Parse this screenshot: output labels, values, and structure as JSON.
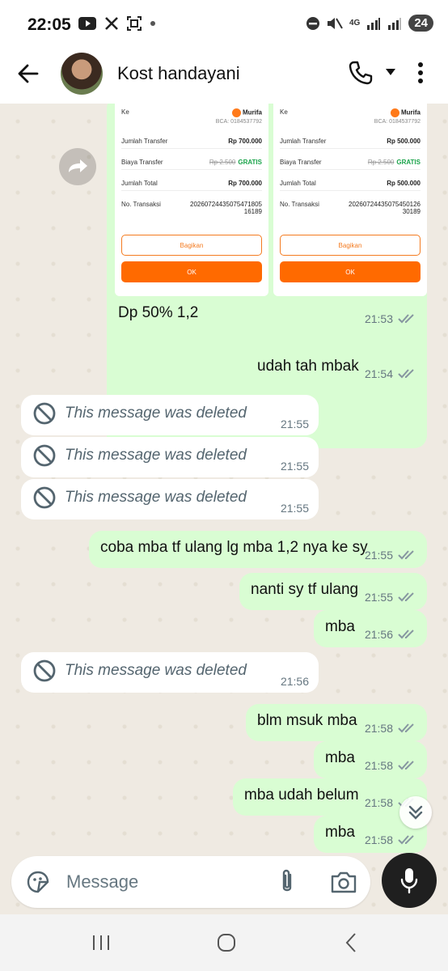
{
  "status_bar": {
    "time": "22:05",
    "network": "4G",
    "battery": "24",
    "notification_icons": [
      "youtube-icon",
      "x-icon",
      "screenshot-icon",
      "dot-icon"
    ]
  },
  "header": {
    "contact_name": "Kost handayani"
  },
  "receipts": [
    {
      "to_label": "Ke",
      "recipient": "Murifa",
      "bank": "BCA: 0184537792",
      "rows": [
        {
          "label": "Jumlah Transfer",
          "value": "Rp 700.000"
        },
        {
          "label": "Biaya Transfer",
          "strike": "Rp 2.500",
          "value": "GRATIS"
        },
        {
          "label": "Jumlah Total",
          "value": "Rp 700.000"
        },
        {
          "label": "No. Transaksi",
          "value": "20260724435075471805 16189"
        }
      ],
      "share_label": "Bagikan",
      "ok_label": "OK"
    },
    {
      "to_label": "Ke",
      "recipient": "Murifa",
      "bank": "BCA: 0184537792",
      "rows": [
        {
          "label": "Jumlah Transfer",
          "value": "Rp 500.000"
        },
        {
          "label": "Biaya Transfer",
          "strike": "Rp 2.500",
          "value": "GRATIS"
        },
        {
          "label": "Jumlah Total",
          "value": "Rp 500.000"
        },
        {
          "label": "No. Transaksi",
          "value": "20260724435075450126 30189"
        }
      ],
      "share_label": "Bagikan",
      "ok_label": "OK"
    }
  ],
  "image_caption": {
    "text": "Dp 50% 1,2",
    "time": "21:53"
  },
  "messages": [
    {
      "dir": "out",
      "text": "udah tah mbak",
      "time": "21:54"
    },
    {
      "dir": "in",
      "deleted": true,
      "text": "This message was deleted",
      "time": "21:55"
    },
    {
      "dir": "in",
      "deleted": true,
      "text": "This message was deleted",
      "time": "21:55"
    },
    {
      "dir": "in",
      "deleted": true,
      "text": "This message was deleted",
      "time": "21:55"
    },
    {
      "dir": "out",
      "text": "coba mba tf ulang lg mba 1,2 nya ke sy",
      "time": "21:55"
    },
    {
      "dir": "out",
      "text": "nanti sy tf ulang",
      "time": "21:55"
    },
    {
      "dir": "out",
      "text": "mba",
      "time": "21:56"
    },
    {
      "dir": "in",
      "deleted": true,
      "text": "This message was deleted",
      "time": "21:56"
    },
    {
      "dir": "out",
      "text": "blm msuk mba",
      "time": "21:58"
    },
    {
      "dir": "out",
      "text": "mba",
      "time": "21:58"
    },
    {
      "dir": "out",
      "text": "mba udah belum",
      "time": "21:58"
    },
    {
      "dir": "out",
      "text": "mba",
      "time": "21:58"
    }
  ],
  "input": {
    "placeholder": "Message"
  },
  "colors": {
    "outgoing_bubble": "#d9fdd3",
    "incoming_bubble": "#ffffff",
    "read_tick": "#53bdeb",
    "accent": "#ff6a00"
  }
}
